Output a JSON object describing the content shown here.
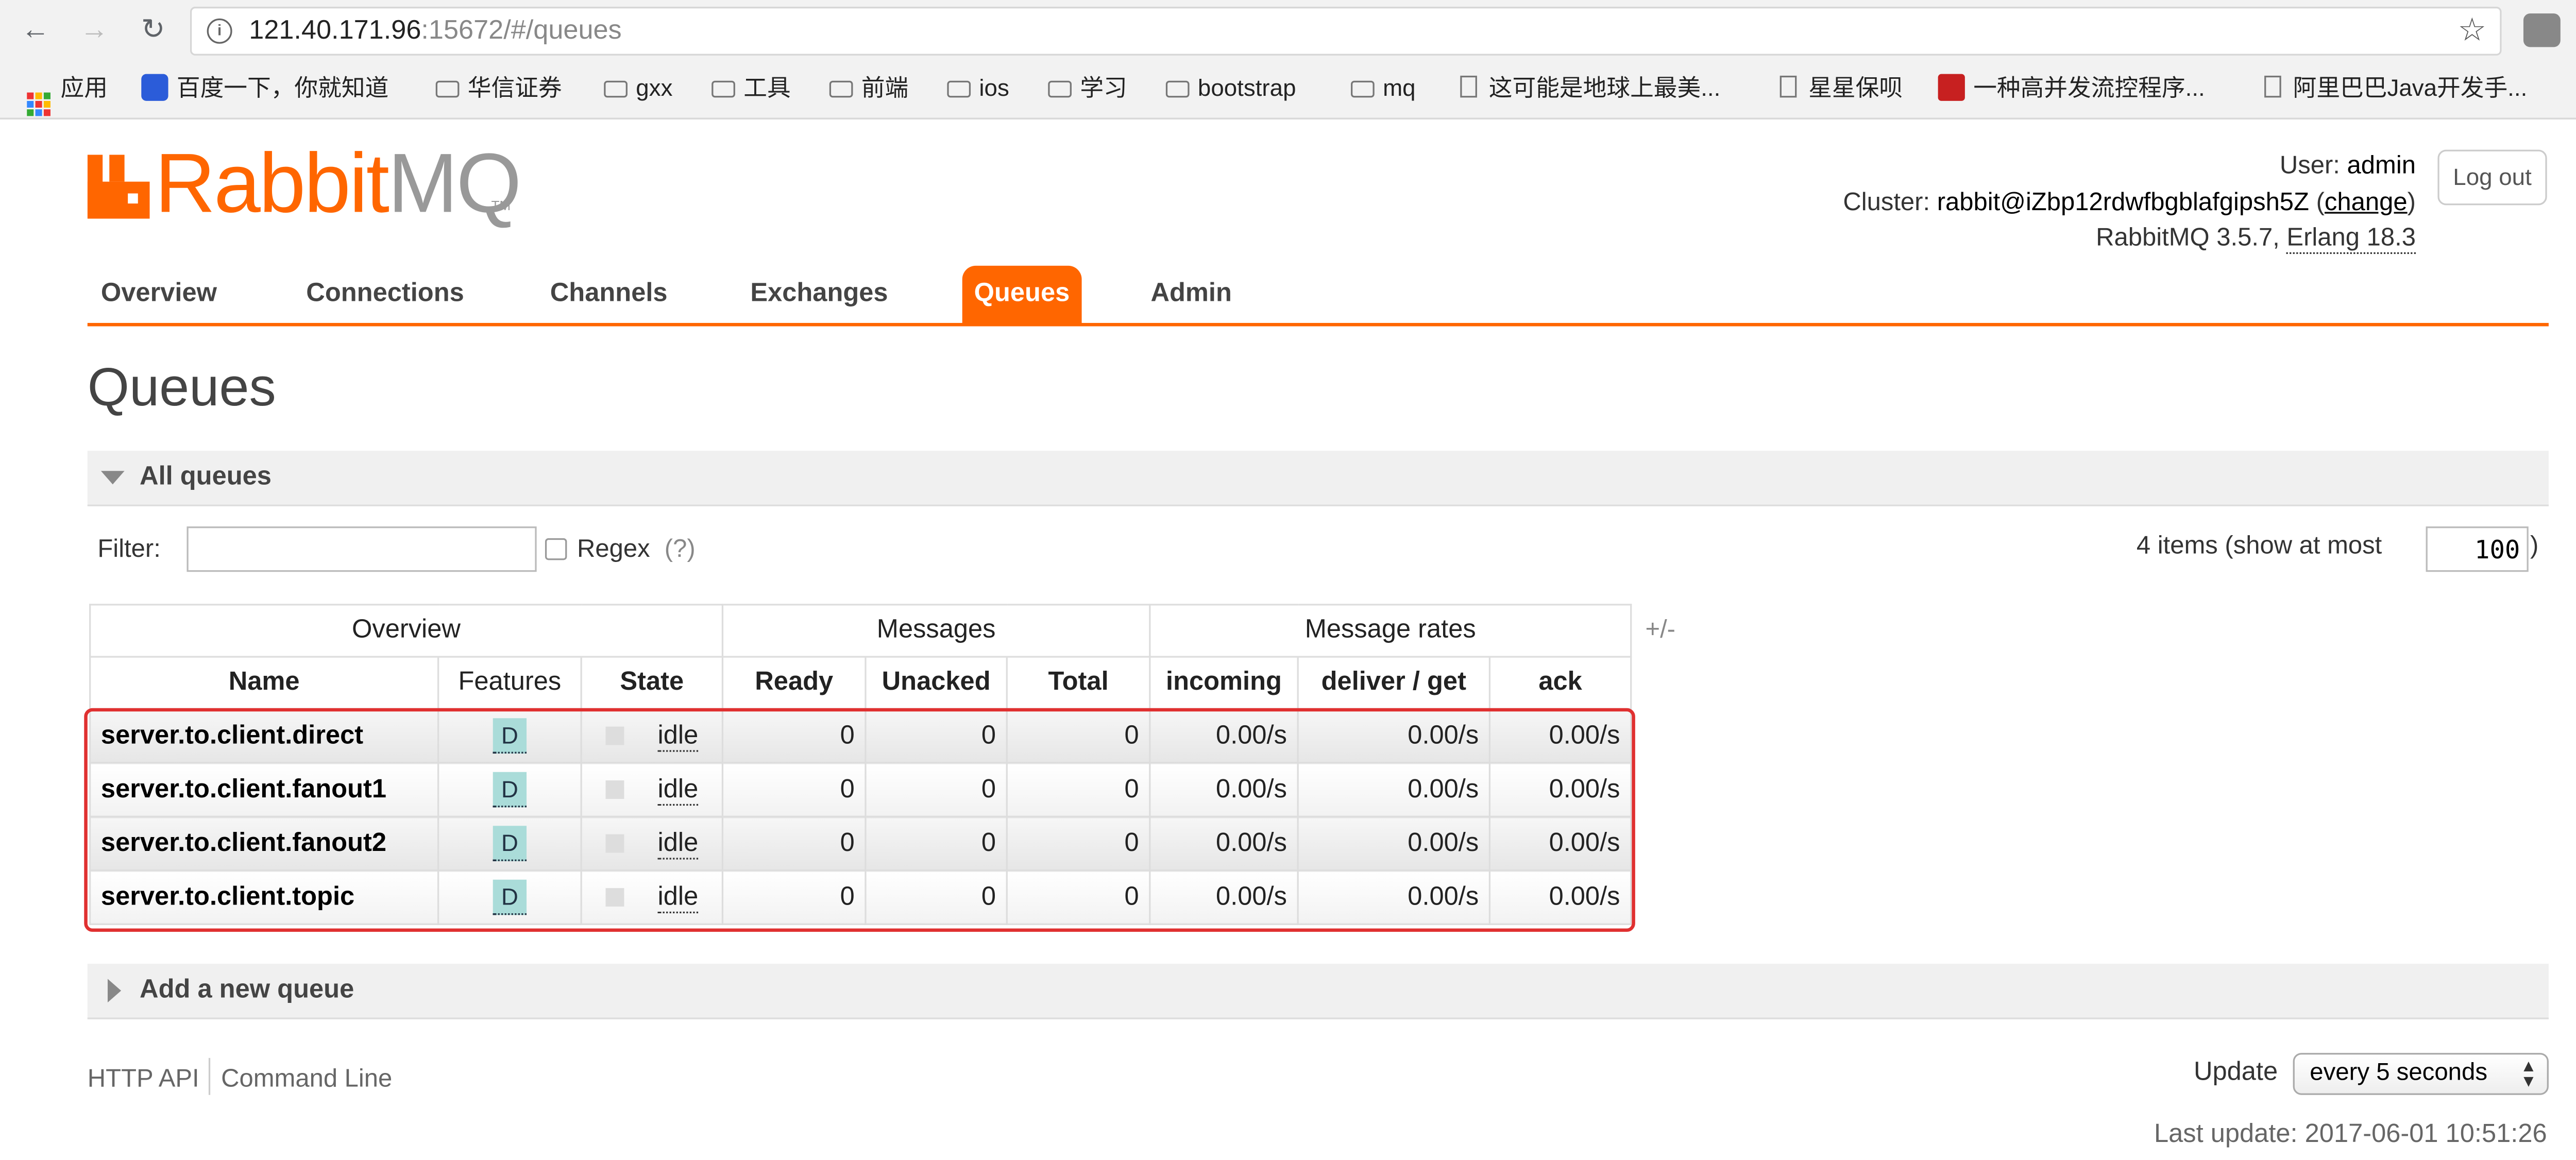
{
  "browser": {
    "url_host": "121.40.171.96",
    "url_rest": ":15672/#/queues",
    "bookmarks": [
      {
        "label": "应用",
        "icon": "apps-grid-icon"
      },
      {
        "label": "百度一下，你就知道",
        "icon": "baidu-paw-icon"
      },
      {
        "label": "华信证券",
        "icon": "folder-icon"
      },
      {
        "label": "gxx",
        "icon": "folder-icon"
      },
      {
        "label": "工具",
        "icon": "folder-icon"
      },
      {
        "label": "前端",
        "icon": "folder-icon"
      },
      {
        "label": "ios",
        "icon": "folder-icon"
      },
      {
        "label": "学习",
        "icon": "folder-icon"
      },
      {
        "label": "bootstrap",
        "icon": "folder-icon"
      },
      {
        "label": "mq",
        "icon": "folder-icon"
      },
      {
        "label": "这可能是地球上最美...",
        "icon": "page-icon"
      },
      {
        "label": "星星保呗",
        "icon": "page-icon"
      },
      {
        "label": "一种高并发流控程序...",
        "icon": "csdn-icon"
      },
      {
        "label": "阿里巴巴Java开发手...",
        "icon": "page-icon"
      }
    ],
    "more": "»"
  },
  "header": {
    "logo_rabbit": "Rabbit",
    "logo_mq": "MQ",
    "logo_tm": "TM",
    "user_label": "User:",
    "user_value": "admin",
    "cluster_label": "Cluster:",
    "cluster_value": "rabbit@iZbp12rdwfbgblafgipsh5Z",
    "change_label": "change",
    "version_text": "RabbitMQ 3.5.7,",
    "erlang_text": "Erlang 18.3",
    "logout_label": "Log out"
  },
  "tabs": [
    "Overview",
    "Connections",
    "Channels",
    "Exchanges",
    "Queues",
    "Admin"
  ],
  "active_tab": "Queues",
  "page_title": "Queues",
  "all_queues_label": "All queues",
  "filter": {
    "label": "Filter:",
    "value": "",
    "regex_label": "Regex",
    "regex_help": "(?)",
    "items_text": "4 items (show at most",
    "max_items": "100",
    "items_close": ")"
  },
  "table": {
    "groups": [
      "Overview",
      "Messages",
      "Message rates"
    ],
    "columns": [
      "Name",
      "Features",
      "State",
      "Ready",
      "Unacked",
      "Total",
      "incoming",
      "deliver / get",
      "ack"
    ],
    "plusminus": "+/-",
    "rows": [
      {
        "name": "server.to.client.direct",
        "feature": "D",
        "state": "idle",
        "ready": "0",
        "unacked": "0",
        "total": "0",
        "incoming": "0.00/s",
        "deliver_get": "0.00/s",
        "ack": "0.00/s"
      },
      {
        "name": "server.to.client.fanout1",
        "feature": "D",
        "state": "idle",
        "ready": "0",
        "unacked": "0",
        "total": "0",
        "incoming": "0.00/s",
        "deliver_get": "0.00/s",
        "ack": "0.00/s"
      },
      {
        "name": "server.to.client.fanout2",
        "feature": "D",
        "state": "idle",
        "ready": "0",
        "unacked": "0",
        "total": "0",
        "incoming": "0.00/s",
        "deliver_get": "0.00/s",
        "ack": "0.00/s"
      },
      {
        "name": "server.to.client.topic",
        "feature": "D",
        "state": "idle",
        "ready": "0",
        "unacked": "0",
        "total": "0",
        "incoming": "0.00/s",
        "deliver_get": "0.00/s",
        "ack": "0.00/s"
      }
    ]
  },
  "add_queue_label": "Add a new queue",
  "footer": {
    "http_api": "HTTP API",
    "command_line": "Command Line",
    "update_label": "Update",
    "update_value": "every 5 seconds",
    "last_update": "Last update: 2017-06-01 10:51:26"
  },
  "colors": {
    "brand": "#ff6600",
    "highlight": "#e03030",
    "feature_badge": "#aadcd9"
  }
}
